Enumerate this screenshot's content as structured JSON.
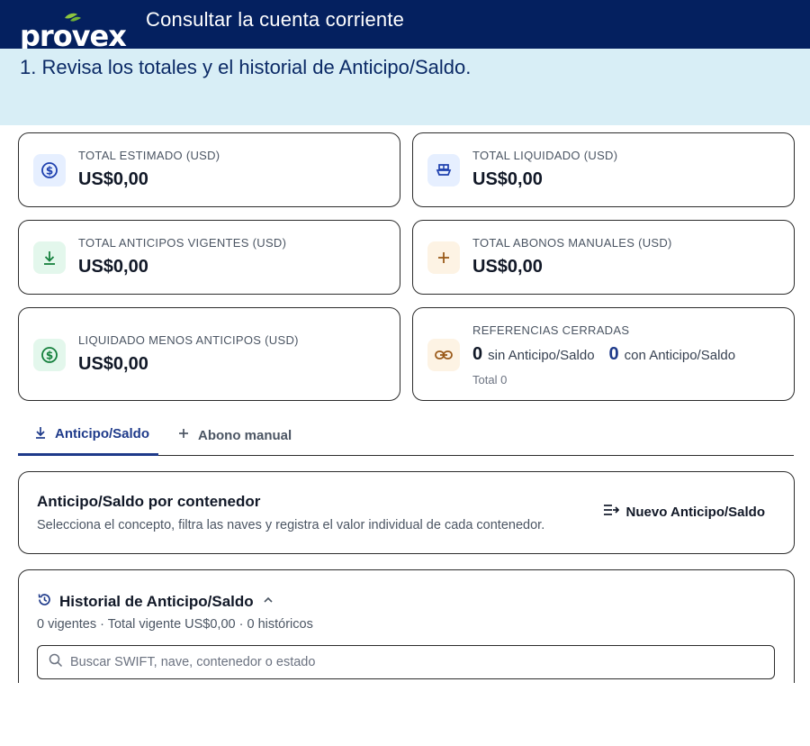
{
  "header": {
    "logo_text": "provex",
    "title": "Consultar la cuenta corriente"
  },
  "instruction": {
    "text": "1. Revisa los totales y el historial de Anticipo/Saldo."
  },
  "cards": {
    "estimado": {
      "label": "TOTAL ESTIMADO (USD)",
      "value": "US$0,00",
      "icon": "dollar-circle-icon"
    },
    "liquidado": {
      "label": "TOTAL LIQUIDADO (USD)",
      "value": "US$0,00",
      "icon": "ship-icon"
    },
    "anticipos": {
      "label": "TOTAL ANTICIPOS VIGENTES (USD)",
      "value": "US$0,00",
      "icon": "download-icon"
    },
    "abonos": {
      "label": "TOTAL ABONOS MANUALES (USD)",
      "value": "US$0,00",
      "icon": "plus-icon"
    },
    "liq_menos": {
      "label": "LIQUIDADO MENOS ANTICIPOS (USD)",
      "value": "US$0,00",
      "icon": "dollar-circle-icon"
    },
    "referencias": {
      "label": "REFERENCIAS CERRADAS",
      "icon": "link-icon",
      "sin_count": "0",
      "sin_label": "sin Anticipo/Saldo",
      "con_count": "0",
      "con_label": "con Anticipo/Saldo",
      "total": "Total 0"
    }
  },
  "tabs": [
    {
      "label": "Anticipo/Saldo",
      "icon": "download-icon",
      "active": true
    },
    {
      "label": "Abono manual",
      "icon": "plus-icon",
      "active": false
    }
  ],
  "anticipo_panel": {
    "title": "Anticipo/Saldo por contenedor",
    "subtitle": "Selecciona el concepto, filtra las naves y registra el valor individual de cada contenedor.",
    "new_button": "Nuevo Anticipo/Saldo"
  },
  "historial": {
    "title": "Historial de Anticipo/Saldo",
    "summary": "0 vigentes · Total vigente US$0,00 · 0 históricos",
    "search_placeholder": "Buscar SWIFT, nave, contenedor o estado"
  },
  "colors": {
    "header_bg": "#04205f",
    "instruction_bg": "#d8eef6",
    "accent": "#1e3a8a",
    "logo_leaf": "#8dc63f"
  }
}
